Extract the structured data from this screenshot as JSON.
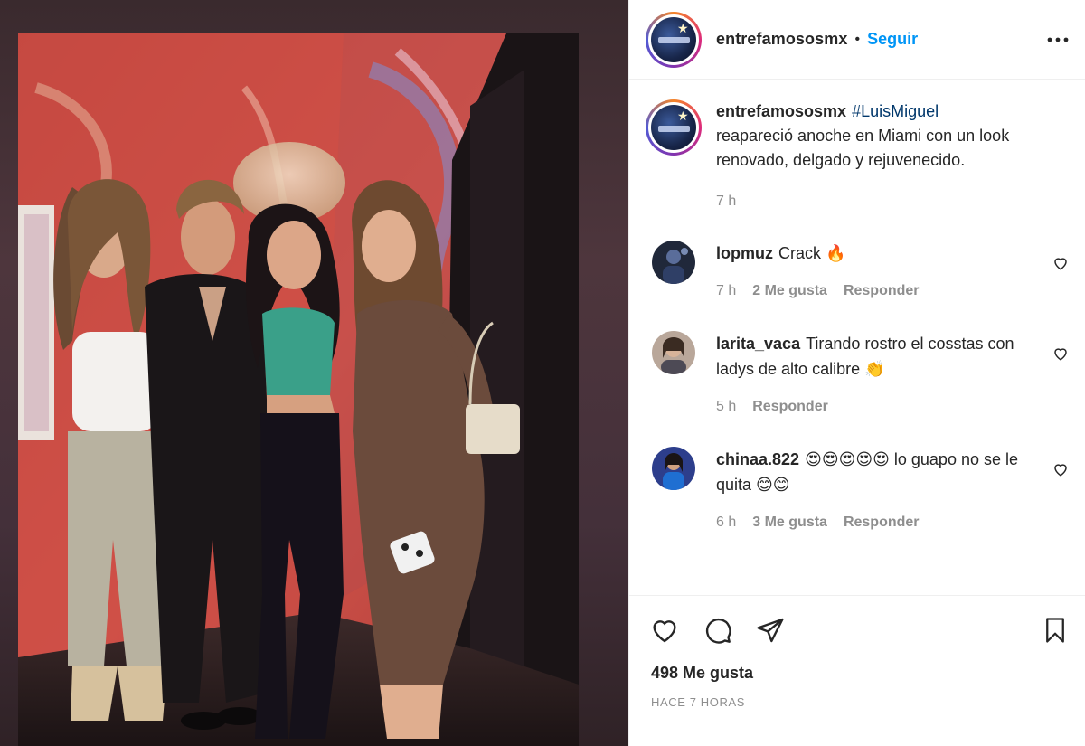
{
  "post": {
    "username": "entrefamososmx",
    "follow_label": "Seguir",
    "separator": "•",
    "caption": {
      "username": "entrefamososmx",
      "hashtag": "#LuisMiguel",
      "text": "reapareció anoche en Miami con un look renovado, delgado y rejuvenecido.",
      "time": "7 h"
    },
    "comments": [
      {
        "username": "lopmuz",
        "text": "Crack 🔥",
        "time": "7 h",
        "likes": "2 Me gusta",
        "reply": "Responder"
      },
      {
        "username": "larita_vaca",
        "text": "Tirando rostro el cosstas con ladys de alto calibre 👏",
        "time": "5 h",
        "reply": "Responder"
      },
      {
        "username": "chinaa.822",
        "text": "😍😍😍😍😍 lo guapo no se le quita 😊😊",
        "time": "6 h",
        "likes": "3 Me gusta",
        "reply": "Responder"
      }
    ],
    "likes_count": "498 Me gusta",
    "posted_ago": "HACE 7 HORAS"
  },
  "icons": {
    "more": "more-options-icon",
    "like": "heart-icon",
    "comment": "comment-icon",
    "share": "paper-plane-icon",
    "save": "bookmark-icon"
  },
  "colors": {
    "link_blue": "#0095f6",
    "hashtag": "#00376b",
    "muted": "#8e8e8e",
    "text": "#262626"
  }
}
